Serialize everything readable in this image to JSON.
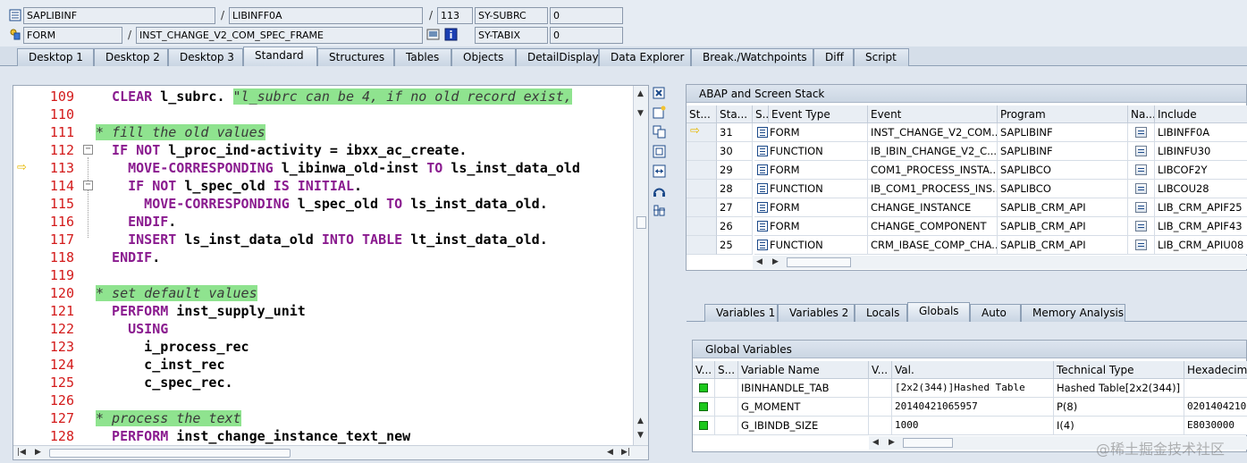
{
  "header": {
    "program": "SAPLIBINF",
    "include": "LIBINFF0A",
    "line": "113",
    "sy_subrc_label": "SY-SUBRC",
    "sy_subrc_value": "0",
    "event_type": "FORM",
    "event_name": "INST_CHANGE_V2_COM_SPEC_FRAME",
    "sy_tabix_label": "SY-TABIX",
    "sy_tabix_value": "0",
    "slash": "/"
  },
  "tabs": [
    {
      "label": "Desktop 1"
    },
    {
      "label": "Desktop 2"
    },
    {
      "label": "Desktop 3"
    },
    {
      "label": "Standard"
    },
    {
      "label": "Structures"
    },
    {
      "label": "Tables"
    },
    {
      "label": "Objects"
    },
    {
      "label": "DetailDisplay"
    },
    {
      "label": "Data Explorer"
    },
    {
      "label": "Break./Watchpoints"
    },
    {
      "label": "Diff"
    },
    {
      "label": "Script"
    }
  ],
  "code_lines": [
    {
      "num": "109",
      "text": "  CLEAR l_subrc. ",
      "comment": "\"l_subrc can be 4, if no old record exist,"
    },
    {
      "num": "110",
      "text": "",
      "comment": ""
    },
    {
      "num": "111",
      "text": "",
      "comment": "* fill the old values"
    },
    {
      "num": "112",
      "text": "  IF NOT l_proc_ind-activity = ibxx_ac_create.",
      "comment": ""
    },
    {
      "num": "113",
      "text": "    MOVE-CORRESPONDING l_ibinwa_old-inst TO ls_inst_data_old",
      "comment": ""
    },
    {
      "num": "114",
      "text": "    IF NOT l_spec_old IS INITIAL.",
      "comment": ""
    },
    {
      "num": "115",
      "text": "      MOVE-CORRESPONDING l_spec_old TO ls_inst_data_old.",
      "comment": ""
    },
    {
      "num": "116",
      "text": "    ENDIF.",
      "comment": ""
    },
    {
      "num": "117",
      "text": "    INSERT ls_inst_data_old INTO TABLE lt_inst_data_old.",
      "comment": ""
    },
    {
      "num": "118",
      "text": "  ENDIF.",
      "comment": ""
    },
    {
      "num": "119",
      "text": "",
      "comment": ""
    },
    {
      "num": "120",
      "text": "",
      "comment": "* set default values"
    },
    {
      "num": "121",
      "text": "  PERFORM inst_supply_unit",
      "comment": ""
    },
    {
      "num": "122",
      "text": "    USING",
      "comment": ""
    },
    {
      "num": "123",
      "text": "      i_process_rec",
      "comment": ""
    },
    {
      "num": "124",
      "text": "      c_inst_rec",
      "comment": ""
    },
    {
      "num": "125",
      "text": "      c_spec_rec.",
      "comment": ""
    },
    {
      "num": "126",
      "text": "",
      "comment": ""
    },
    {
      "num": "127",
      "text": "",
      "comment": "* process the text"
    },
    {
      "num": "128",
      "text": "  PERFORM inst_change_instance_text_new",
      "comment": ""
    }
  ],
  "stack": {
    "title": "ABAP and Screen Stack",
    "columns": [
      "St...",
      "Sta...",
      "S...",
      "Event Type",
      "Event",
      "Program",
      "Na...",
      "Include"
    ],
    "rows": [
      {
        "level": "31",
        "type": "FORM",
        "event": "INST_CHANGE_V2_COM...",
        "program": "SAPLIBINF",
        "include": "LIBINFF0A",
        "current": true
      },
      {
        "level": "30",
        "type": "FUNCTION",
        "event": "IB_IBIN_CHANGE_V2_C...",
        "program": "SAPLIBINF",
        "include": "LIBINFU30",
        "current": false
      },
      {
        "level": "29",
        "type": "FORM",
        "event": "COM1_PROCESS_INSTA...",
        "program": "SAPLIBCO",
        "include": "LIBCOF2Y",
        "current": false
      },
      {
        "level": "28",
        "type": "FUNCTION",
        "event": "IB_COM1_PROCESS_INS...",
        "program": "SAPLIBCO",
        "include": "LIBCOU28",
        "current": false
      },
      {
        "level": "27",
        "type": "FORM",
        "event": "CHANGE_INSTANCE",
        "program": "SAPLIB_CRM_API",
        "include": "LIB_CRM_APIF25",
        "current": false
      },
      {
        "level": "26",
        "type": "FORM",
        "event": "CHANGE_COMPONENT",
        "program": "SAPLIB_CRM_API",
        "include": "LIB_CRM_APIF43",
        "current": false
      },
      {
        "level": "25",
        "type": "FUNCTION",
        "event": "CRM_IBASE_COMP_CHA...",
        "program": "SAPLIB_CRM_API",
        "include": "LIB_CRM_APIU08",
        "current": false
      }
    ]
  },
  "var_tabs": [
    {
      "label": "Variables 1"
    },
    {
      "label": "Variables 2"
    },
    {
      "label": "Locals"
    },
    {
      "label": "Globals"
    },
    {
      "label": "Auto"
    },
    {
      "label": "Memory Analysis"
    }
  ],
  "globals": {
    "title": "Global Variables",
    "columns": [
      "V...",
      "S...",
      "Variable Name",
      "V...",
      "Val.",
      "Technical Type",
      "Hexadecimal"
    ],
    "rows": [
      {
        "name": "IBINHANDLE_TAB",
        "value": "[2x2(344)]Hashed Table",
        "type": "Hashed Table[2x2(344)]",
        "hex": ""
      },
      {
        "name": "G_MOMENT",
        "value": "20140421065957",
        "type": "P(8)",
        "hex": "0201404210"
      },
      {
        "name": "G_IBINDB_SIZE",
        "value": "1000",
        "type": "I(4)",
        "hex": "E8030000"
      }
    ]
  },
  "watermark": "@稀土掘金技术社区"
}
